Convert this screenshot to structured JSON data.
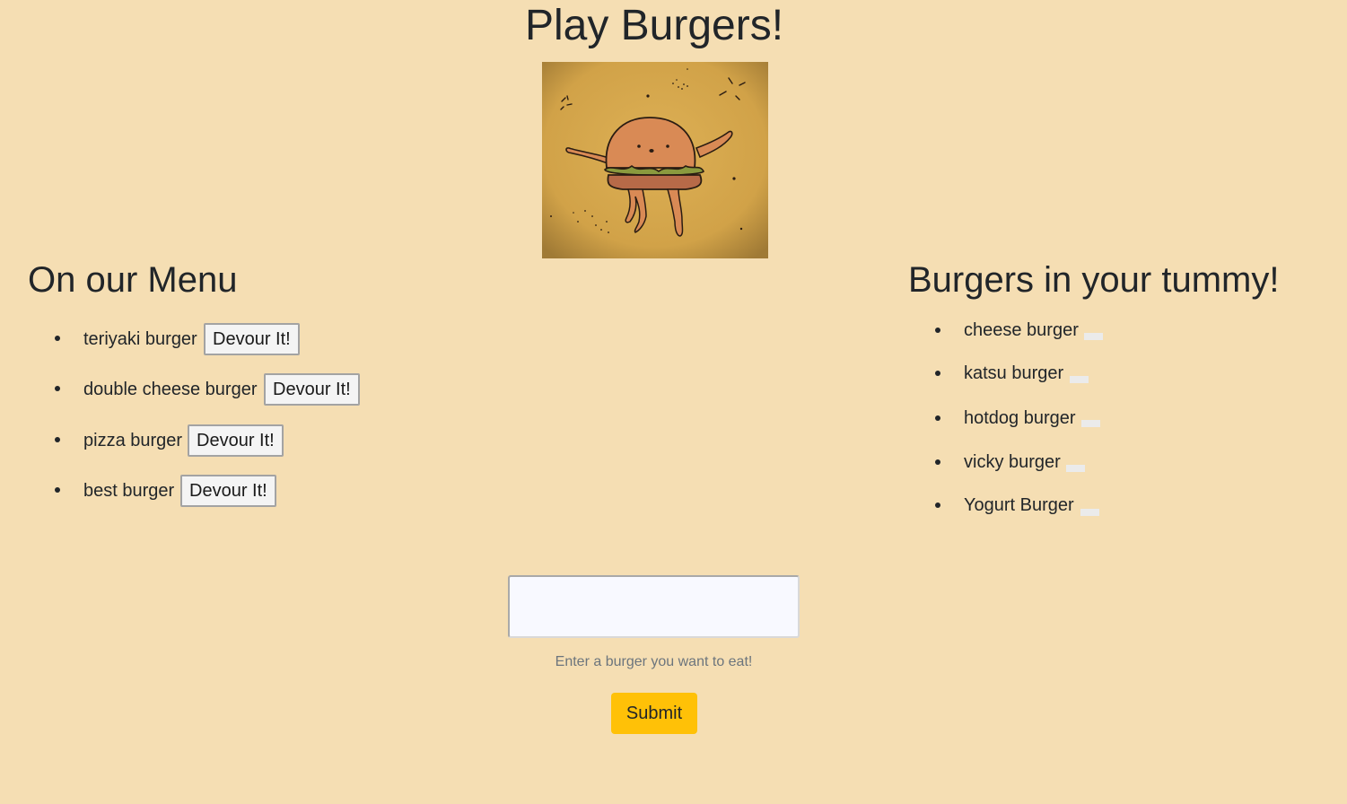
{
  "header": {
    "title": "Play Burgers!"
  },
  "hero": {
    "image_name": "dancing-burger-illustration",
    "colors": {
      "background": "#d4a64a",
      "bun": "#d98a55",
      "lettuce": "#8a9a3e",
      "patty": "#b76a48"
    }
  },
  "menu": {
    "heading": "On our Menu",
    "items": [
      {
        "name": "teriyaki burger",
        "button_label": "Devour It!"
      },
      {
        "name": "double cheese burger",
        "button_label": "Devour It!"
      },
      {
        "name": "pizza burger",
        "button_label": "Devour It!"
      },
      {
        "name": "best burger",
        "button_label": "Devour It!"
      }
    ]
  },
  "tummy": {
    "heading": "Burgers in your tummy!",
    "items": [
      {
        "name": "cheese burger"
      },
      {
        "name": "katsu burger"
      },
      {
        "name": "hotdog burger"
      },
      {
        "name": "vicky burger"
      },
      {
        "name": "Yogurt Burger"
      }
    ]
  },
  "form": {
    "input_value": "",
    "help_text": "Enter a burger you want to eat!",
    "submit_label": "Submit"
  },
  "colors": {
    "page_background": "#f5deb3",
    "submit_button": "#ffc107",
    "text": "#212529",
    "muted_text": "#6c757d"
  }
}
